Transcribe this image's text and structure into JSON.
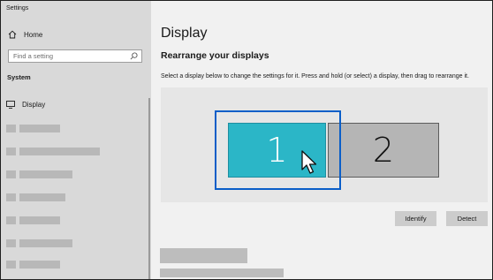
{
  "window": {
    "title": "Settings"
  },
  "sidebar": {
    "home_label": "Home",
    "search_placeholder": "Find a setting",
    "section": "System",
    "active_item": "Display"
  },
  "main": {
    "title": "Display",
    "subtitle": "Rearrange your displays",
    "instructions": "Select a display below to change the settings for it. Press and hold (or select) a display, then drag to rearrange it.",
    "monitors": [
      {
        "label": "1",
        "selected": true
      },
      {
        "label": "2",
        "selected": false
      }
    ],
    "identify_label": "Identify",
    "detect_label": "Detect"
  },
  "colors": {
    "accent": "#0a5ec8",
    "selected_monitor": "#2bb6c7",
    "other_monitor": "#b5b5b5"
  }
}
